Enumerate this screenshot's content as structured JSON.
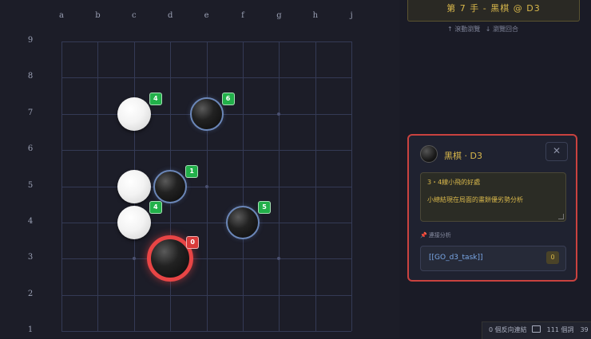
{
  "board": {
    "columns": [
      "a",
      "b",
      "c",
      "d",
      "e",
      "f",
      "g",
      "h",
      "j"
    ],
    "rows": [
      "9",
      "8",
      "7",
      "6",
      "5",
      "4",
      "3",
      "2",
      "1"
    ],
    "stones": [
      {
        "color": "white",
        "col": "c",
        "row": "7",
        "badge": "4",
        "badge_color": "green",
        "last": false
      },
      {
        "color": "black",
        "col": "e",
        "row": "7",
        "badge": "6",
        "badge_color": "green",
        "last": false
      },
      {
        "color": "white",
        "col": "c",
        "row": "5",
        "badge": "",
        "badge_color": "",
        "last": false
      },
      {
        "color": "black",
        "col": "d",
        "row": "5",
        "badge": "1",
        "badge_color": "green",
        "last": false
      },
      {
        "color": "white",
        "col": "c",
        "row": "4",
        "badge": "4",
        "badge_color": "green",
        "last": false
      },
      {
        "color": "black",
        "col": "f",
        "row": "4",
        "badge": "5",
        "badge_color": "green",
        "last": false
      },
      {
        "color": "black",
        "col": "d",
        "row": "3",
        "badge": "0",
        "badge_color": "red",
        "last": true
      }
    ]
  },
  "header": {
    "move_title": "第 7 手 - 黑棋 @ D3",
    "hint_scroll": "↑ 滾動瀏覽",
    "hint_browse": "↓ 瀏覽回合"
  },
  "panel": {
    "title": "黑棋 · D3",
    "close_label": "✕",
    "note_line1": "3・4線小飛的好處",
    "note_line2": "小總結現在局面的畫餅優劣勢分析",
    "link_label": "連接分析",
    "link_text": "[[GO_d3_task]]",
    "link_count": "0"
  },
  "status_bar": {
    "backlinks": "0 個反向連結",
    "words": "111 個詞",
    "chars": "39"
  },
  "colors": {
    "accent_gold": "#d9b84b",
    "highlight_red": "#e84545",
    "badge_green": "#22b04a"
  }
}
